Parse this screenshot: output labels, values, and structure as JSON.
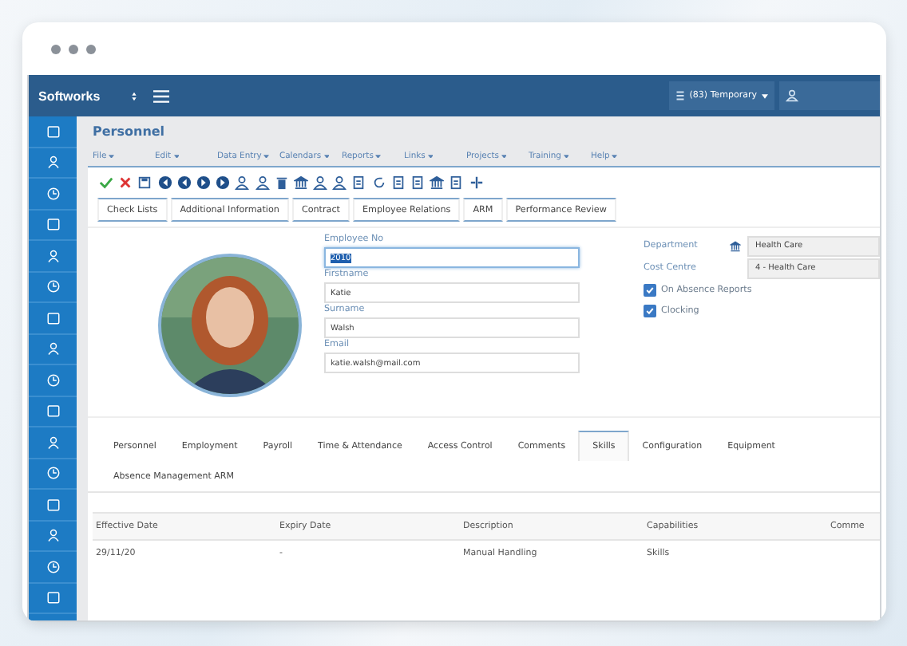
{
  "header": {
    "logo": "Softworks",
    "user_selector": "(83) Temporary"
  },
  "page_title": "Personnel",
  "menu": [
    {
      "label": "File"
    },
    {
      "label": "Edit"
    },
    {
      "label": "Data Entry"
    },
    {
      "label": "Calendars"
    },
    {
      "label": "Reports"
    },
    {
      "label": "Links"
    },
    {
      "label": "Projects"
    },
    {
      "label": "Training"
    },
    {
      "label": "Help"
    }
  ],
  "action_buttons": [
    "Check Lists",
    "Additional Information",
    "Contract",
    "Employee Relations",
    "ARM",
    "Performance Review"
  ],
  "fields": [
    {
      "label": "Employee No",
      "value": "2010",
      "focused": true
    },
    {
      "label": "Firstname",
      "value": "Katie",
      "focused": false
    },
    {
      "label": "Surname",
      "value": "Walsh",
      "focused": false
    },
    {
      "label": "Email",
      "value": "katie.walsh@mail.com",
      "focused": false
    }
  ],
  "department": {
    "label": "Department",
    "value": "Health Care"
  },
  "cost_centre": {
    "label": "Cost Centre",
    "value": "4 - Health Care"
  },
  "checkboxes": [
    {
      "label": "On Absence Reports",
      "checked": true
    },
    {
      "label": "Clocking",
      "checked": true
    }
  ],
  "tabs": [
    {
      "label": "Personnel",
      "selected": false
    },
    {
      "label": "Employment",
      "selected": false
    },
    {
      "label": "Payroll",
      "selected": false
    },
    {
      "label": "Time & Attendance",
      "selected": false
    },
    {
      "label": "Access Control",
      "selected": false
    },
    {
      "label": "Comments",
      "selected": false
    },
    {
      "label": "Skills",
      "selected": true
    },
    {
      "label": "Configuration",
      "selected": false
    },
    {
      "label": "Equipment",
      "selected": false
    },
    {
      "label": "Absence Management ARM",
      "selected": false
    }
  ],
  "table": {
    "columns": [
      "Effective Date",
      "Expiry Date",
      "Description",
      "Capabilities",
      "Comme"
    ],
    "rows": [
      [
        "29/11/20",
        "-",
        "Manual Handling",
        "Skills"
      ]
    ]
  }
}
